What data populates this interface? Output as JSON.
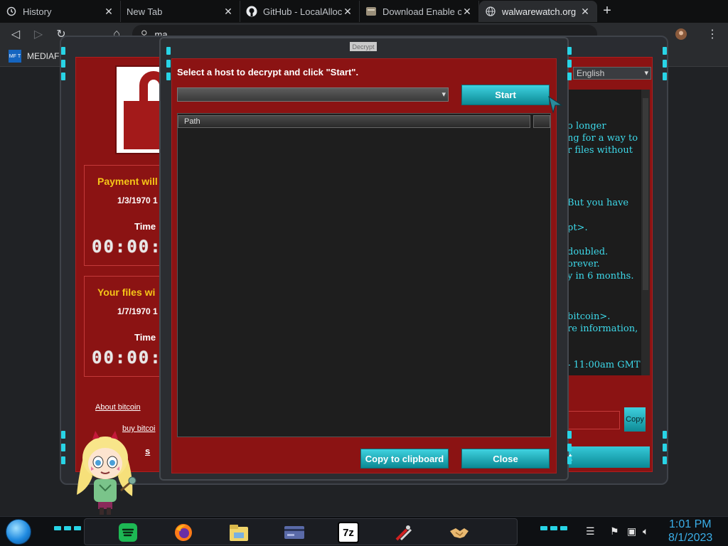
{
  "browser": {
    "tabs": [
      {
        "label": "History",
        "icon": "history-icon"
      },
      {
        "label": "New Tab",
        "icon": ""
      },
      {
        "label": "GitHub - LocalAlloc/",
        "icon": "github-icon"
      },
      {
        "label": "Download Enable or",
        "icon": "page-icon"
      },
      {
        "label": "walwarewatch.org",
        "icon": "globe-icon"
      }
    ],
    "new_tab_symbol": "+",
    "omnibox_text": "ma",
    "bookmark_label": "MEDIAFI",
    "bookmark_icon_text": "MF T"
  },
  "ransom_window": {
    "payment_title": "Payment will",
    "payment_date": "1/3/1970 1",
    "payment_time_label": "Time",
    "payment_digits": "00:00:",
    "files_title": "Your files wi",
    "files_date": "1/7/1970 1",
    "files_time_label": "Time",
    "files_digits": "00:00:",
    "about_bitcoin": "About bitcoin",
    "buy_bitcoin": "buy bitcoi",
    "contact": "s",
    "language": "English",
    "message_lines": [
      "o longer",
      "ng for a way to",
      "r files without",
      "But you have",
      "pt>.",
      "doubled.",
      "orever.",
      "y in 6 months.",
      " bitcoin>.",
      "re information,",
      " - 11:00am GMT"
    ],
    "copy_label": "Copy",
    "check_label": "t"
  },
  "decrypt_dialog": {
    "title": "Decrypt",
    "prompt": "Select a host to decrypt and click \"Start\".",
    "host_value": "",
    "start_label": "Start",
    "column_path": "Path",
    "copy_clipboard_label": "Copy to clipboard",
    "close_label": "Close"
  },
  "taskbar": {
    "time": "1:01 PM",
    "date": "8/1/2023",
    "apps": [
      "spotify-icon",
      "firefox-icon",
      "file-explorer-icon",
      "card-icon",
      "7zip-icon",
      "tools-icon",
      "handshake-icon"
    ],
    "sevenzip_label": "7z"
  },
  "colors": {
    "accent_cyan": "#28d4e6",
    "window_red": "#8b1313",
    "title_yellow": "#f5c518",
    "clock_blue": "#3aaee8"
  }
}
